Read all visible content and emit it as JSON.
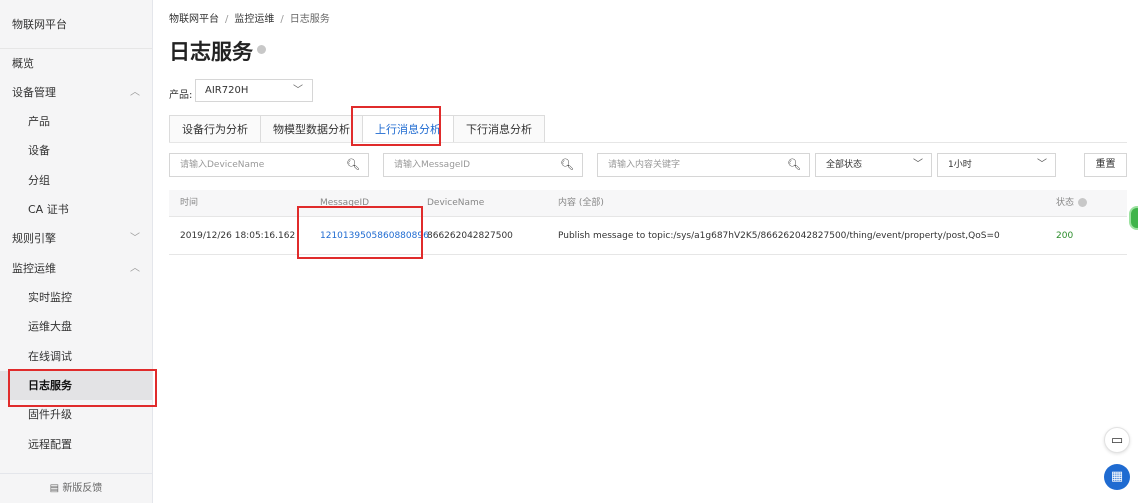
{
  "sidebar": {
    "title": "物联网平台",
    "items": [
      {
        "label": "概览"
      },
      {
        "label": "设备管理",
        "chevron": "︿"
      },
      {
        "label": "产品"
      },
      {
        "label": "设备"
      },
      {
        "label": "分组"
      },
      {
        "label": "CA 证书"
      },
      {
        "label": "规则引擎",
        "chevron": "﹀"
      },
      {
        "label": "监控运维",
        "chevron": "︿"
      },
      {
        "label": "实时监控"
      },
      {
        "label": "运维大盘"
      },
      {
        "label": "在线调试"
      },
      {
        "label": "日志服务"
      },
      {
        "label": "固件升级"
      },
      {
        "label": "远程配置"
      }
    ],
    "feedback": "新版反馈"
  },
  "breadcrumb": {
    "items": [
      "物联网平台",
      "监控运维",
      "日志服务"
    ],
    "separator": "/"
  },
  "page": {
    "title": "日志服务",
    "product_label": "产品:",
    "product_value": "AIR720H"
  },
  "tabs": [
    {
      "label": "设备行为分析"
    },
    {
      "label": "物模型数据分析"
    },
    {
      "label": "上行消息分析"
    },
    {
      "label": "下行消息分析"
    }
  ],
  "filters": {
    "device_placeholder": "请输入DeviceName",
    "message_placeholder": "请输入MessageID",
    "keyword_placeholder": "请输入内容关键字",
    "status_value": "全部状态",
    "time_value": "1小时",
    "reset_label": "重置"
  },
  "table": {
    "headers": [
      "时间",
      "MessageID",
      "DeviceName",
      "内容 (全部)",
      "状态"
    ],
    "rows": [
      {
        "time": "2019/12/26 18:05:16.162",
        "message_id": "1210139505860880896",
        "device_name": "866262042827500",
        "content": "Publish message to topic:/sys/a1g687hV2K5/866262042827500/thing/event/property/post,QoS=0",
        "status": "200"
      }
    ]
  },
  "icons": {
    "search": "search-icon",
    "chevron": "chevron-down-icon",
    "chat": "chat-icon",
    "apps": "apps-icon"
  },
  "colors": {
    "accent": "#1f6bd1",
    "highlight": "#e02b2b",
    "success": "#2a8c2a"
  }
}
